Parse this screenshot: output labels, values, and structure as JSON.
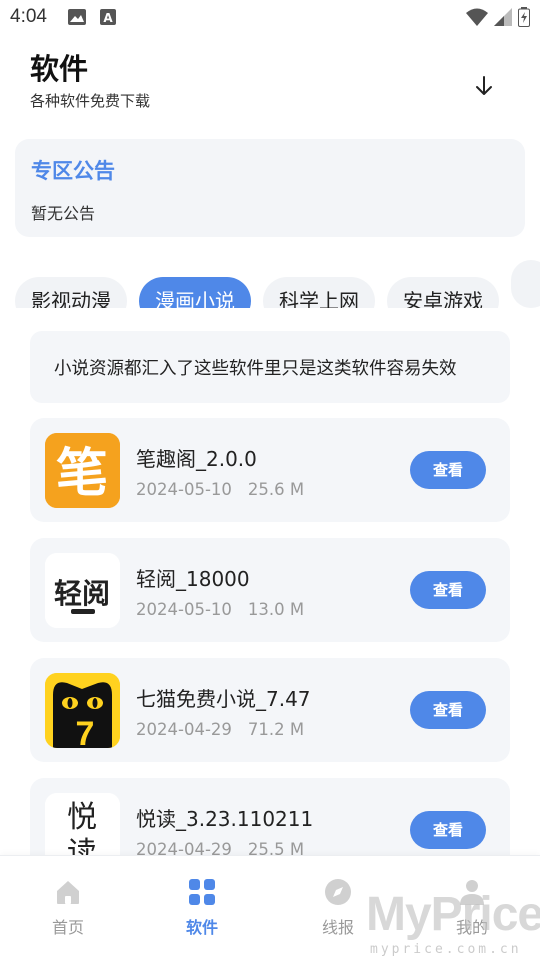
{
  "status_bar": {
    "time": "4:04"
  },
  "header": {
    "title": "软件",
    "subtitle": "各种软件免费下载"
  },
  "notice": {
    "title": "专区公告",
    "body": "暂无公告"
  },
  "tabs": [
    {
      "label": "影视动漫",
      "active": false
    },
    {
      "label": "漫画小说",
      "active": true
    },
    {
      "label": "科学上网",
      "active": false
    },
    {
      "label": "安卓游戏",
      "active": false
    }
  ],
  "category_description": "小说资源都汇入了这些软件里只是这类软件容易失效",
  "apps": [
    {
      "name": "笔趣阁_2.0.0",
      "date": "2024-05-10",
      "size": "25.6 M",
      "button_label": "查看",
      "icon_text": "笔"
    },
    {
      "name": "轻阅_18000",
      "date": "2024-05-10",
      "size": "13.0 M",
      "button_label": "查看",
      "icon_text": "轻阅"
    },
    {
      "name": "七猫免费小说_7.47",
      "date": "2024-04-29",
      "size": "71.2 M",
      "button_label": "查看",
      "icon_text": "7"
    },
    {
      "name": "悦读_3.23.110211",
      "date": "2024-04-29",
      "size": "25.5 M",
      "button_label": "查看",
      "icon_text": "悦读"
    }
  ],
  "bottom_nav": [
    {
      "label": "首页",
      "icon": "home-icon",
      "active": false
    },
    {
      "label": "软件",
      "icon": "grid-icon",
      "active": true
    },
    {
      "label": "线报",
      "icon": "compass-icon",
      "active": false
    },
    {
      "label": "我的",
      "icon": "user-icon",
      "active": false
    }
  ],
  "watermark": {
    "main": "MyPrice",
    "sub": "myprice.com.cn"
  },
  "colors": {
    "accent": "#4f88e8",
    "card_bg": "#f4f6f9",
    "muted": "#999999"
  }
}
